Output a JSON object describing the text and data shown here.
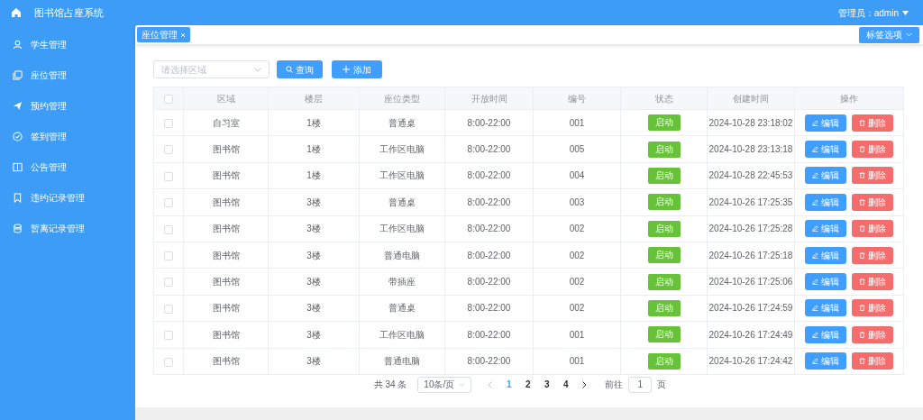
{
  "header": {
    "title": "图书馆占座系统",
    "user": "管理员：admin"
  },
  "sidebar": {
    "items": [
      {
        "label": "学生管理"
      },
      {
        "label": "座位管理"
      },
      {
        "label": "预约管理"
      },
      {
        "label": "签到管理"
      },
      {
        "label": "公告管理"
      },
      {
        "label": "违约记录管理"
      },
      {
        "label": "暂离记录管理"
      }
    ]
  },
  "tabs": [
    {
      "label": "座位管理",
      "selected": true
    }
  ],
  "tab_options": "标签选项",
  "filter": {
    "placeholder": "请选择区域",
    "search_button": "查询",
    "add_button": "添加"
  },
  "table": {
    "columns": [
      "区域",
      "楼层",
      "座位类型",
      "开放时间",
      "编号",
      "状态",
      "创建时间",
      "操作"
    ],
    "header_checked": false,
    "rows": [
      {
        "checked": false,
        "area": "自习室",
        "floor": "1楼",
        "type": "普通桌",
        "hours": "8:00-22:00",
        "number": "001",
        "status": "启动",
        "created": "2024-10-28 23:18:02",
        "edit": "编辑",
        "delete": "删除"
      },
      {
        "checked": false,
        "area": "图书馆",
        "floor": "1楼",
        "type": "工作区电脑",
        "hours": "8:00-22:00",
        "number": "005",
        "status": "启动",
        "created": "2024-10-28 23:13:18",
        "edit": "编辑",
        "delete": "删除"
      },
      {
        "checked": false,
        "area": "图书馆",
        "floor": "1楼",
        "type": "工作区电脑",
        "hours": "8:00-22:00",
        "number": "004",
        "status": "启动",
        "created": "2024-10-28 22:45:53",
        "edit": "编辑",
        "delete": "删除"
      },
      {
        "checked": false,
        "area": "图书馆",
        "floor": "3楼",
        "type": "普通桌",
        "hours": "8:00-22:00",
        "number": "003",
        "status": "启动",
        "created": "2024-10-26 17:25:35",
        "edit": "编辑",
        "delete": "删除"
      },
      {
        "checked": false,
        "area": "图书馆",
        "floor": "3楼",
        "type": "工作区电脑",
        "hours": "8:00-22:00",
        "number": "002",
        "status": "启动",
        "created": "2024-10-26 17:25:28",
        "edit": "编辑",
        "delete": "删除"
      },
      {
        "checked": false,
        "area": "图书馆",
        "floor": "3楼",
        "type": "普通电脑",
        "hours": "8:00-22:00",
        "number": "002",
        "status": "启动",
        "created": "2024-10-26 17:25:18",
        "edit": "编辑",
        "delete": "删除"
      },
      {
        "checked": false,
        "area": "图书馆",
        "floor": "3楼",
        "type": "带插座",
        "hours": "8:00-22:00",
        "number": "002",
        "status": "启动",
        "created": "2024-10-26 17:25:06",
        "edit": "编辑",
        "delete": "删除"
      },
      {
        "checked": false,
        "area": "图书馆",
        "floor": "3楼",
        "type": "普通桌",
        "hours": "8:00-22:00",
        "number": "002",
        "status": "启动",
        "created": "2024-10-26 17:24:59",
        "edit": "编辑",
        "delete": "删除"
      },
      {
        "checked": false,
        "area": "图书馆",
        "floor": "3楼",
        "type": "工作区电脑",
        "hours": "8:00-22:00",
        "number": "001",
        "status": "启动",
        "created": "2024-10-26 17:24:49",
        "edit": "编辑",
        "delete": "删除"
      },
      {
        "checked": false,
        "area": "图书馆",
        "floor": "3楼",
        "type": "普通电脑",
        "hours": "8:00-22:00",
        "number": "001",
        "status": "启动",
        "created": "2024-10-26 17:24:42",
        "edit": "编辑",
        "delete": "删除"
      }
    ]
  },
  "pagination": {
    "total": "共 34 条",
    "page_size": "10条/页",
    "pages": [
      {
        "label": "1",
        "selected": true
      },
      {
        "label": "2",
        "selected": false
      },
      {
        "label": "3",
        "selected": false
      },
      {
        "label": "4",
        "selected": false
      }
    ],
    "goto_label": "前往",
    "goto_value": "1",
    "goto_suffix": "页"
  }
}
